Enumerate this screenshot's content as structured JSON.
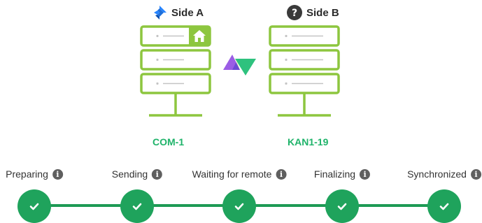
{
  "side_a": {
    "title": "Side A",
    "icon": "jira-logo-icon",
    "issue_key": "COM-1",
    "has_home_badge": true
  },
  "side_b": {
    "title": "Side B",
    "icon": "question-mark-icon",
    "issue_key": "KAN1-19"
  },
  "colors": {
    "server_outline": "#8dc63f",
    "issue_key": "#1fb36a",
    "step_complete": "#1fa35c",
    "progress_line": "#1e9a55"
  },
  "steps": [
    {
      "label": "Preparing",
      "status": "complete"
    },
    {
      "label": "Sending",
      "status": "complete"
    },
    {
      "label": "Waiting for remote",
      "status": "complete"
    },
    {
      "label": "Finalizing",
      "status": "complete"
    },
    {
      "label": "Synchronized",
      "status": "complete"
    }
  ]
}
